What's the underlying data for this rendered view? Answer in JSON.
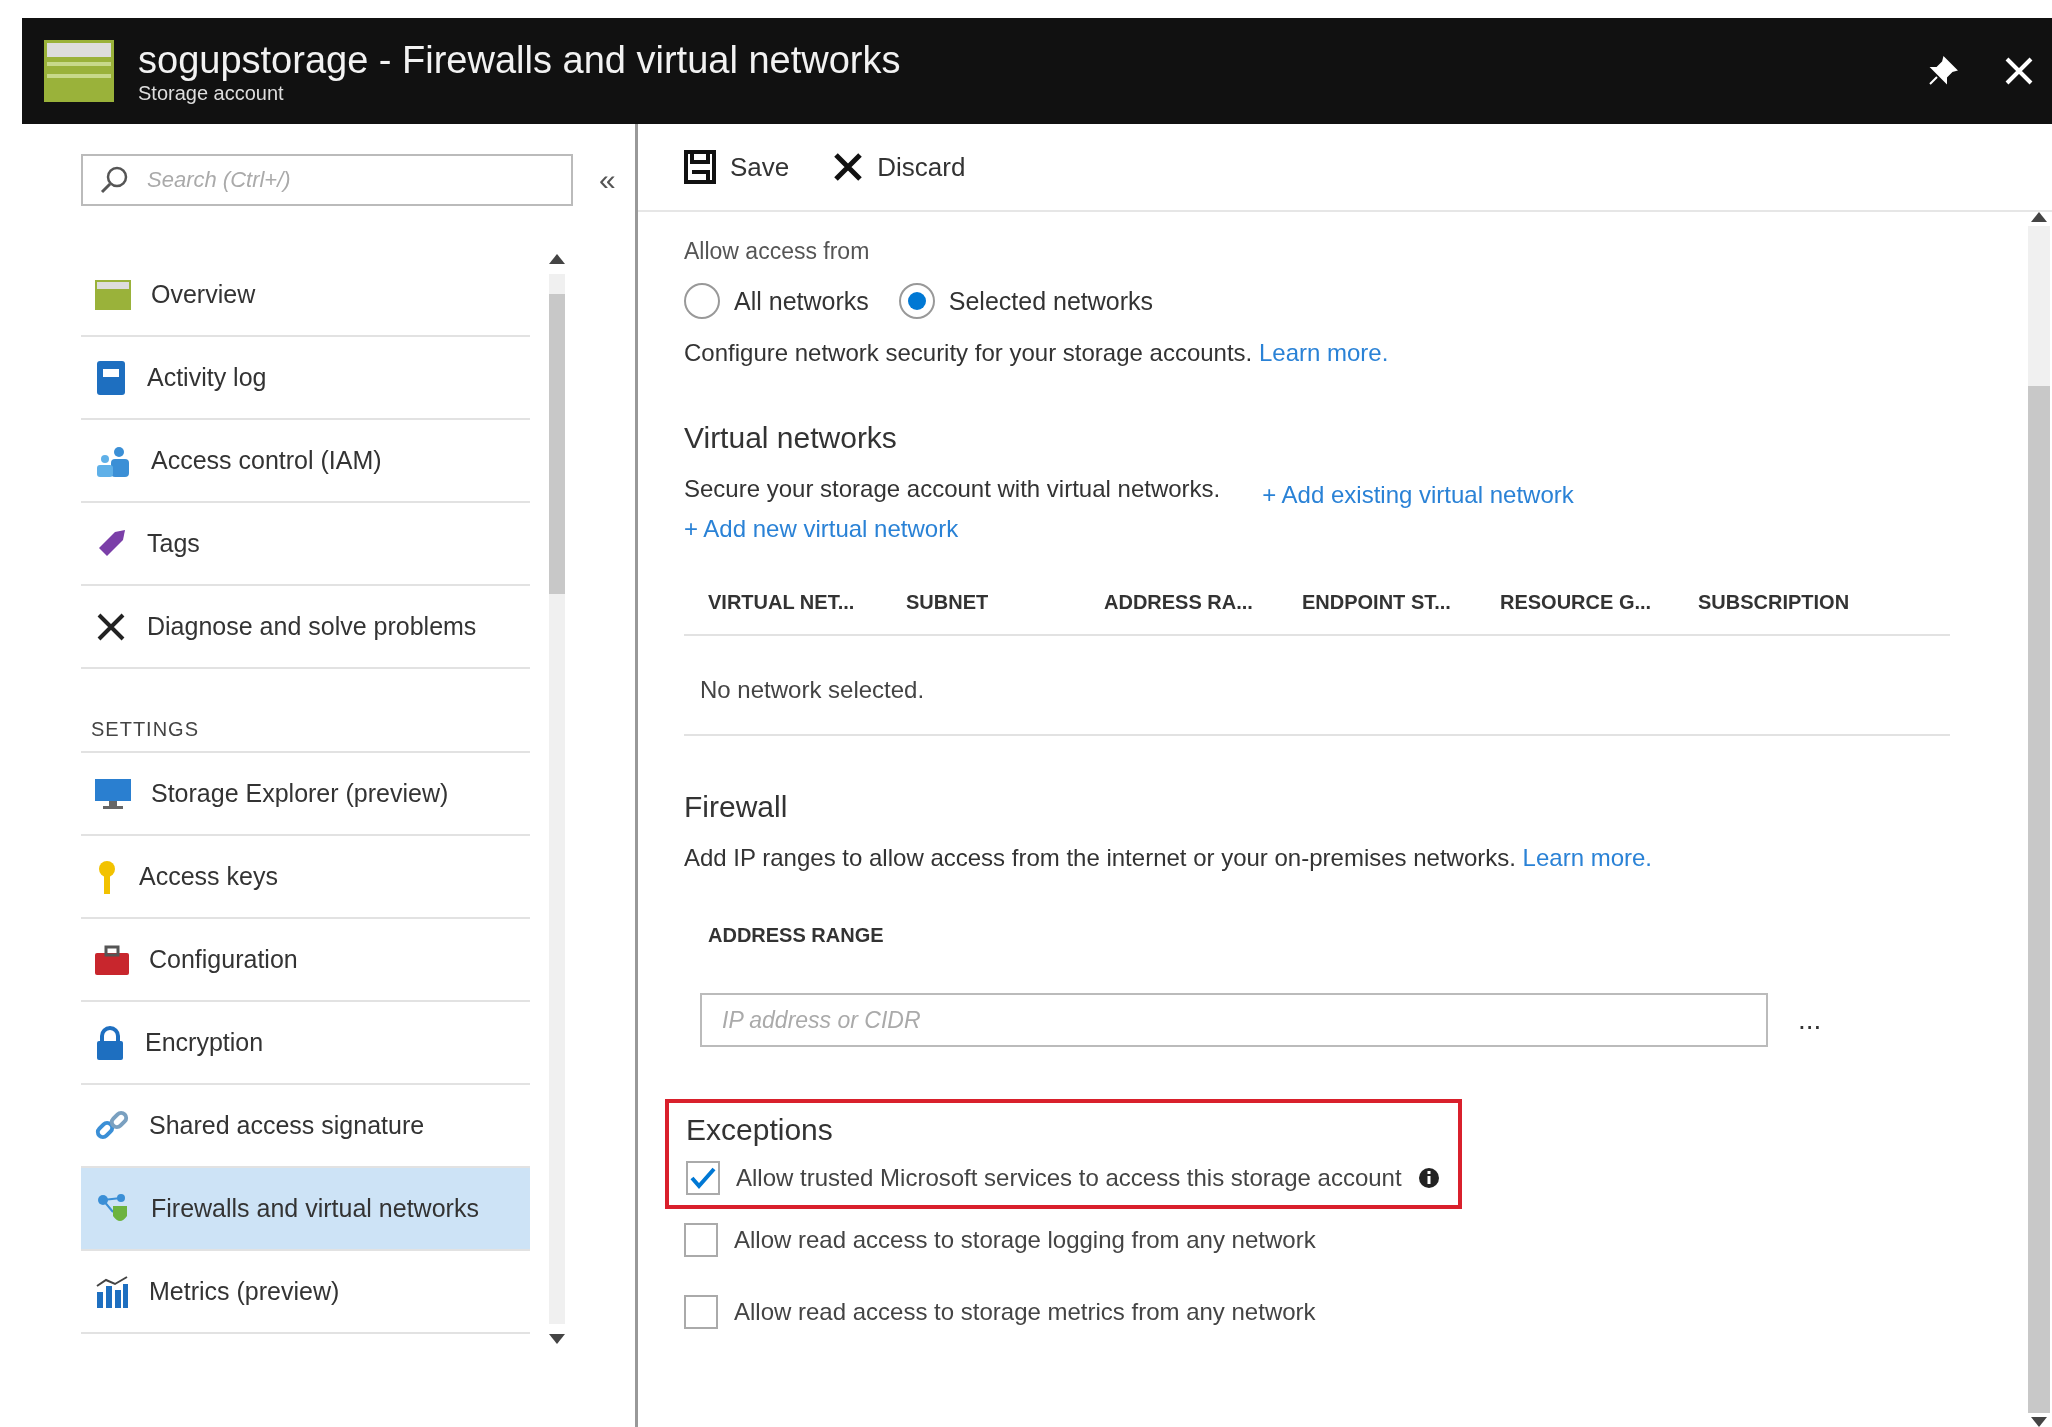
{
  "header": {
    "title": "sogupstorage - Firewalls and virtual networks",
    "subtitle": "Storage account"
  },
  "search": {
    "placeholder": "Search (Ctrl+/)"
  },
  "collapse_label": "«",
  "sidebar": {
    "groups": [
      {
        "items": [
          {
            "label": "Overview",
            "selected": false
          },
          {
            "label": "Activity log",
            "selected": false
          },
          {
            "label": "Access control (IAM)",
            "selected": false
          },
          {
            "label": "Tags",
            "selected": false
          },
          {
            "label": "Diagnose and solve problems",
            "selected": false
          }
        ]
      },
      {
        "heading": "SETTINGS",
        "items": [
          {
            "label": "Storage Explorer (preview)",
            "selected": false
          },
          {
            "label": "Access keys",
            "selected": false
          },
          {
            "label": "Configuration",
            "selected": false
          },
          {
            "label": "Encryption",
            "selected": false
          },
          {
            "label": "Shared access signature",
            "selected": false
          },
          {
            "label": "Firewalls and virtual networks",
            "selected": true
          },
          {
            "label": "Metrics (preview)",
            "selected": false
          }
        ]
      }
    ]
  },
  "toolbar": [
    {
      "label": "Save"
    },
    {
      "label": "Discard"
    }
  ],
  "access": {
    "label": "Allow access from",
    "options": [
      {
        "label": "All networks",
        "selected": false
      },
      {
        "label": "Selected networks",
        "selected": true
      }
    ],
    "description": "Configure network security for your storage accounts.",
    "link": "Learn more."
  },
  "virtual_networks": {
    "title": "Virtual networks",
    "description": "Secure your storage account with virtual networks.",
    "links": [
      "+ Add existing virtual network",
      "+ Add new virtual network"
    ],
    "table": {
      "columns": [
        "VIRTUAL NET...",
        "SUBNET",
        "ADDRESS RA...",
        "ENDPOINT ST...",
        "RESOURCE G...",
        "SUBSCRIPTION"
      ],
      "empty": "No network selected."
    }
  },
  "firewall": {
    "title": "Firewall",
    "description": "Add IP ranges to allow access from the internet or your on-premises networks.",
    "link": "Learn more.",
    "column": "ADDRESS RANGE",
    "input": {
      "placeholder": "IP address or CIDR"
    },
    "more": "..."
  },
  "exceptions": {
    "title": "Exceptions",
    "highlighted": true,
    "boxed_items": [
      {
        "label": "Allow trusted Microsoft services to access this storage account",
        "checked": true,
        "info": true
      }
    ],
    "items": [
      {
        "label": "Allow read access to storage logging from any network",
        "checked": false
      },
      {
        "label": "Allow read access to storage metrics from any network",
        "checked": false
      }
    ]
  }
}
